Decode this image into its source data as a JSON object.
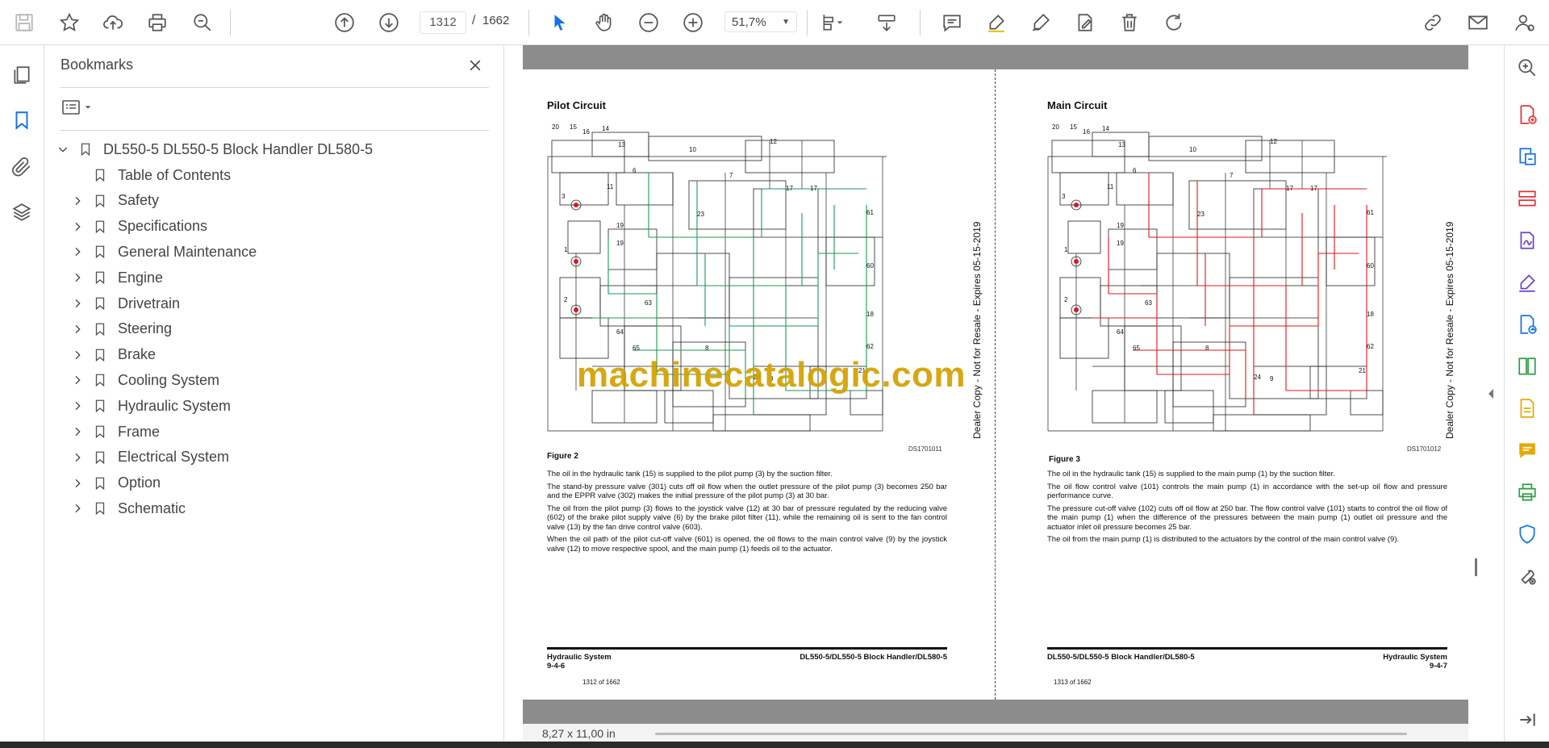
{
  "toolbar": {
    "page_current": "1312",
    "page_separator": "/",
    "page_total": "1662",
    "zoom": "51,7%",
    "icons": [
      "save-icon",
      "star-icon",
      "upload-icon",
      "print-icon",
      "zoom-search-icon",
      "page-up-icon",
      "page-down-icon",
      "select-arrow-icon",
      "hand-icon",
      "zoom-out-icon",
      "zoom-in-icon",
      "fit-page-icon",
      "scroll-mode-icon",
      "comment-icon",
      "highlight-icon",
      "draw-icon",
      "fill-sign-icon",
      "delete-icon",
      "rotate-icon",
      "share-link-icon",
      "email-icon",
      "account-icon"
    ]
  },
  "bookmarks": {
    "title": "Bookmarks",
    "root": "DL550-5 DL550-5 Block Handler DL580-5",
    "items": [
      {
        "label": "Table of Contents",
        "expandable": false
      },
      {
        "label": "Safety",
        "expandable": true
      },
      {
        "label": "Specifications",
        "expandable": true
      },
      {
        "label": "General Maintenance",
        "expandable": true
      },
      {
        "label": "Engine",
        "expandable": true
      },
      {
        "label": "Drivetrain",
        "expandable": true
      },
      {
        "label": "Steering",
        "expandable": true
      },
      {
        "label": "Brake",
        "expandable": true
      },
      {
        "label": "Cooling System",
        "expandable": true
      },
      {
        "label": "Hydraulic System",
        "expandable": true
      },
      {
        "label": "Frame",
        "expandable": true
      },
      {
        "label": "Electrical System",
        "expandable": true
      },
      {
        "label": "Option",
        "expandable": true
      },
      {
        "label": "Schematic",
        "expandable": true
      }
    ]
  },
  "left_page": {
    "title": "Pilot Circuit",
    "figure": "Figure 2",
    "ds_code": "DS1701011",
    "paragraphs": [
      "The oil in the hydraulic tank (15) is supplied to the pilot pump (3) by the suction filter.",
      "The stand-by pressure valve (301) cuts off oil flow when the outlet pressure of the pilot pump (3) becomes 250 bar and the EPPR valve (302) makes the initial pressure of the pilot pump (3) at 30 bar.",
      "The oil from the pilot pump (3) flows to the joystick valve (12) at 30 bar of pressure regulated by the reducing valve (602) of the brake pilot supply valve (6) by the brake pilot filter (11), while the remaining oil is sent to the fan control valve (13) by the fan drive control valve (603).",
      "When the oil path of the pilot cut-off valve (601) is opened, the oil flows to the main control valve (9) by the joystick valve (12) to move respective spool, and the main pump (1) feeds oil to the actuator."
    ],
    "footer_left_1": "Hydraulic System",
    "footer_left_2": "9-4-6",
    "footer_right": "DL550-5/DL550-5 Block Handler/DL580-5",
    "page_count": "1312 of 1662",
    "vertical_note": "Dealer Copy - Not for Resale - Expires 05-15-2019",
    "line_color": "#1a9a55"
  },
  "right_page": {
    "title": "Main Circuit",
    "figure": "Figure 3",
    "ds_code": "DS1701012",
    "paragraphs": [
      "The oil in the hydraulic tank (15) is supplied to the main pump (1) by the suction filter.",
      "The oil flow control valve (101) controls the main pump (1) in accordance with the set-up oil flow and pressure performance curve.",
      "The pressure cut-off valve (102) cuts off oil flow at 250 bar. The flow control valve (101) starts to control the oil flow of the main pump (1) when the difference of the pressures between the main pump (1) outlet oil pressure and the actuator inlet oil pressure becomes 25 bar.",
      "The oil from the main pump (1) is distributed to the actuators by the control of the main control valve (9)."
    ],
    "footer_left": "DL550-5/DL550-5 Block Handler/DL580-5",
    "footer_right_1": "Hydraulic System",
    "footer_right_2": "9-4-7",
    "page_count": "1313 of 1662",
    "vertical_note": "Dealer Copy - Not for Resale - Expires 05-15-2019",
    "line_color": "#e0151d"
  },
  "diagram_labels": [
    "20",
    "15",
    "16",
    "14",
    "10",
    "12",
    "6",
    "7",
    "11",
    "13",
    "3",
    "17",
    "17",
    "61",
    "19",
    "23",
    "1",
    "19",
    "60",
    "2",
    "63",
    "18",
    "64",
    "65",
    "8",
    "62",
    "24",
    "9",
    "21"
  ],
  "watermark": "machinecatalogic.com",
  "status": {
    "page_size": "8,27 x 11,00 in"
  },
  "colors": {
    "accent_blue": "#1473e6",
    "rail_purple": "#6b45c8",
    "rail_red": "#e0333a",
    "rail_green": "#2f9e44",
    "rail_yellow": "#e8a800",
    "watermark": "#d4a000"
  }
}
